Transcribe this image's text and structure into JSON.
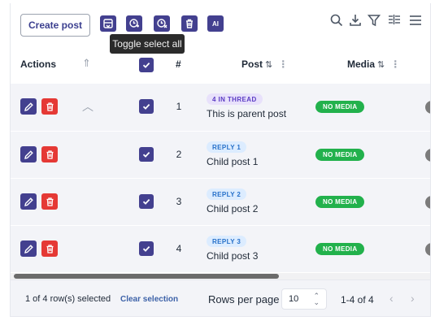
{
  "toolbar": {
    "create_label": "Create post",
    "ai_label": "AI",
    "tooltip": "Toggle select all"
  },
  "columns": {
    "actions": "Actions",
    "number": "#",
    "post": "Post",
    "media": "Media",
    "sort_glyph": "⇅"
  },
  "rows": [
    {
      "num": "1",
      "badge": "4 IN THREAD",
      "badge_kind": "thread",
      "text": "This is parent post",
      "media": "NO MEDIA"
    },
    {
      "num": "2",
      "badge": "REPLY 1",
      "badge_kind": "reply",
      "text": "Child post 1",
      "media": "NO MEDIA"
    },
    {
      "num": "3",
      "badge": "REPLY 2",
      "badge_kind": "reply",
      "text": "Child post 2",
      "media": "NO MEDIA"
    },
    {
      "num": "4",
      "badge": "REPLY 3",
      "badge_kind": "reply",
      "text": "Child post 3",
      "media": "NO MEDIA"
    }
  ],
  "footer": {
    "selected_text": "1 of 4 row(s) selected",
    "clear_label": "Clear selection",
    "rows_per_page_label": "Rows per page",
    "rows_per_page_value": "10",
    "range_text": "1-4 of 4"
  },
  "colors": {
    "accent": "#43408f",
    "danger": "#e53935",
    "media_badge": "#22b14c"
  }
}
